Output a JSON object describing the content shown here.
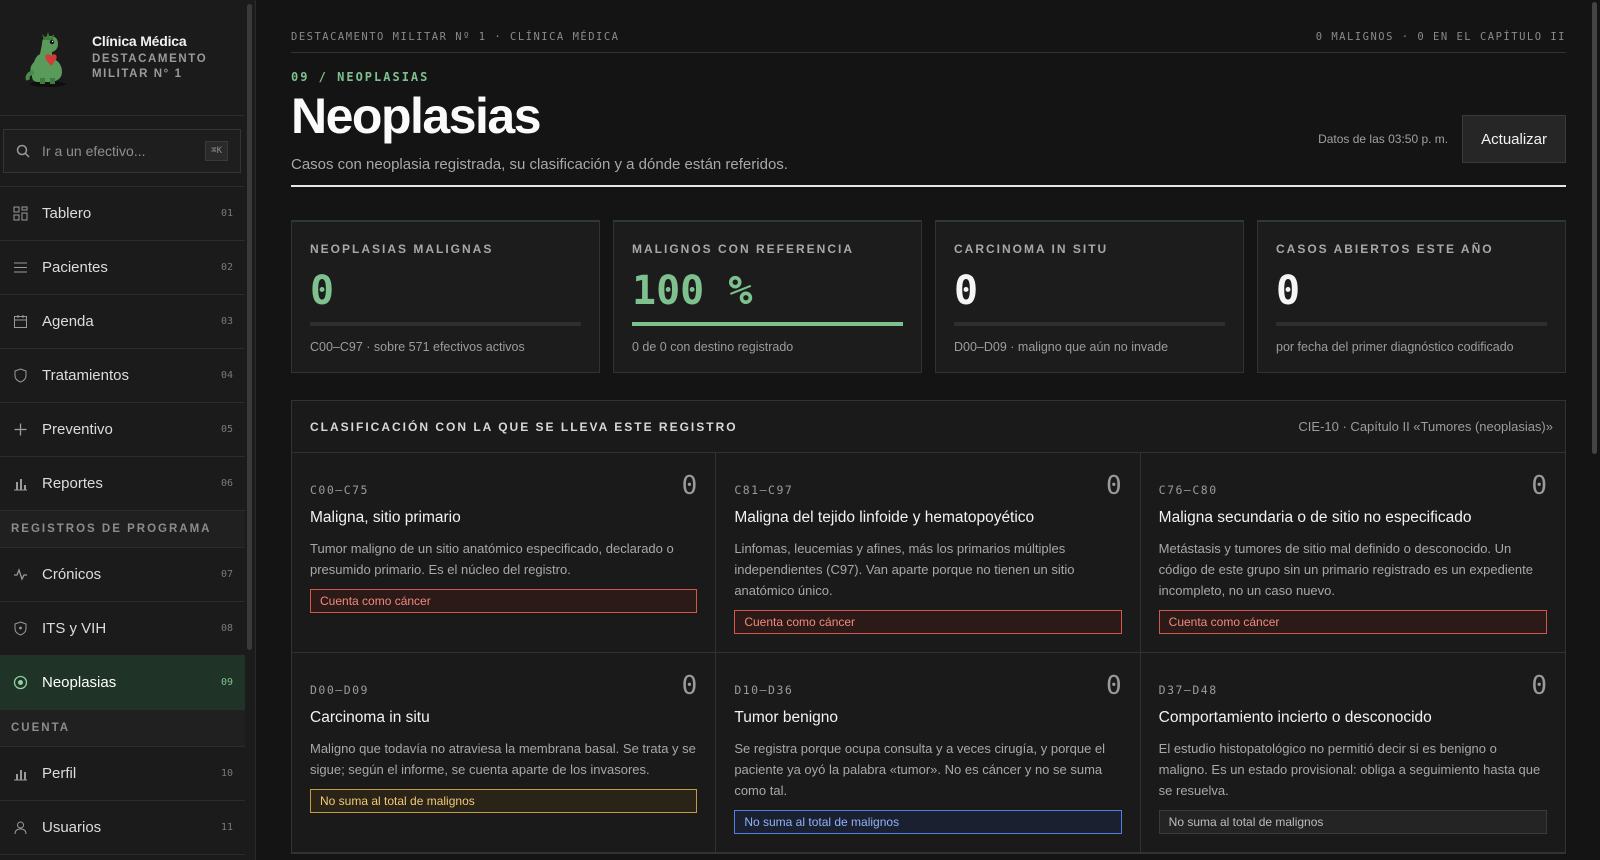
{
  "sidebar": {
    "brand_title": "Clínica Médica",
    "brand_subtitle": "DESTACAMENTO MILITAR N° 1",
    "search_placeholder": "Ir a un efectivo...",
    "search_shortcut": "⌘K",
    "items": [
      {
        "label": "Tablero",
        "num": "01",
        "icon": "grid-icon"
      },
      {
        "label": "Pacientes",
        "num": "02",
        "icon": "list-icon"
      },
      {
        "label": "Agenda",
        "num": "03",
        "icon": "calendar-icon"
      },
      {
        "label": "Tratamientos",
        "num": "04",
        "icon": "shield-icon"
      },
      {
        "label": "Preventivo",
        "num": "05",
        "icon": "plus-icon"
      },
      {
        "label": "Reportes",
        "num": "06",
        "icon": "bar-chart-icon"
      }
    ],
    "section_program": "REGISTROS DE PROGRAMA",
    "program_items": [
      {
        "label": "Crónicos",
        "num": "07",
        "icon": "pulse-icon"
      },
      {
        "label": "ITS y VIH",
        "num": "08",
        "icon": "shield-icon"
      },
      {
        "label": "Neoplasias",
        "num": "09",
        "icon": "target-icon",
        "active": true
      }
    ],
    "section_account": "CUENTA",
    "account_items": [
      {
        "label": "Perfil",
        "num": "10",
        "icon": "bar-chart-icon"
      },
      {
        "label": "Usuarios",
        "num": "11",
        "icon": "user-icon"
      }
    ]
  },
  "topbar": {
    "left": "DESTACAMENTO MILITAR Nº 1 · CLÍNICA MÉDICA",
    "right": "0 MALIGNOS · 0 EN EL CAPÍTULO II"
  },
  "header": {
    "crumb": "09 / NEOPLASIAS",
    "title": "Neoplasias",
    "subtitle": "Casos con neoplasia registrada, su clasificación y a dónde están referidos.",
    "updated": "Datos de las 03:50 p. m.",
    "refresh_label": "Actualizar"
  },
  "kpis": [
    {
      "label": "NEOPLASIAS MALIGNAS",
      "value": "0",
      "note": "C00–C97 · sobre 571 efectivos activos",
      "accent": "green",
      "progress": 0
    },
    {
      "label": "MALIGNOS CON REFERENCIA",
      "value": "100 %",
      "note": "0 de 0 con destino registrado",
      "accent": "green",
      "progress": 1
    },
    {
      "label": "CARCINOMA IN SITU",
      "value": "0",
      "note": "D00–D09 · maligno que aún no invade",
      "accent": "white",
      "progress": 0
    },
    {
      "label": "CASOS ABIERTOS ESTE AÑO",
      "value": "0",
      "note": "por fecha del primer diagnóstico codificado",
      "accent": "white",
      "progress": 0
    }
  ],
  "classification": {
    "heading": "CLASIFICACIÓN CON LA QUE SE LLEVA ESTE REGISTRO",
    "reference": "CIE-10 · Capítulo II «Tumores (neoplasias)»",
    "cells": [
      {
        "code": "C00–C75",
        "count": "0",
        "title": "Maligna, sitio primario",
        "desc": "Tumor maligno de un sitio anatómico especificado, declarado o presumido primario. Es el núcleo del registro.",
        "tag": "Cuenta como cáncer",
        "tag_style": "red"
      },
      {
        "code": "C81–C97",
        "count": "0",
        "title": "Maligna del tejido linfoide y hematopoyético",
        "desc": "Linfomas, leucemias y afines, más los primarios múltiples independientes (C97). Van aparte porque no tienen un sitio anatómico único.",
        "tag": "Cuenta como cáncer",
        "tag_style": "red"
      },
      {
        "code": "C76–C80",
        "count": "0",
        "title": "Maligna secundaria o de sitio no especificado",
        "desc": "Metástasis y tumores de sitio mal definido o desconocido. Un código de este grupo sin un primario registrado es un expediente incompleto, no un caso nuevo.",
        "tag": "Cuenta como cáncer",
        "tag_style": "red"
      },
      {
        "code": "D00–D09",
        "count": "0",
        "title": "Carcinoma in situ",
        "desc": "Maligno que todavía no atraviesa la membrana basal. Se trata y se sigue; según el informe, se cuenta aparte de los invasores.",
        "tag": "No suma al total de malignos",
        "tag_style": "amber"
      },
      {
        "code": "D10–D36",
        "count": "0",
        "title": "Tumor benigno",
        "desc": "Se registra porque ocupa consulta y a veces cirugía, y porque el paciente ya oyó la palabra «tumor». No es cáncer y no se suma como tal.",
        "tag": "No suma al total de malignos",
        "tag_style": "blue"
      },
      {
        "code": "D37–D48",
        "count": "0",
        "title": "Comportamiento incierto o desconocido",
        "desc": "El estudio histopatológico no permitió decir si es benigno o maligno. Es un estado provisional: obliga a seguimiento hasta que se resuelva.",
        "tag": "No suma al total de malignos",
        "tag_style": "gray"
      }
    ]
  },
  "colors": {
    "accent": "#7ec18f",
    "active_bg": "#1f3327",
    "danger": "#d2574a",
    "warning": "#c79a3f",
    "info": "#4f7fe0"
  }
}
